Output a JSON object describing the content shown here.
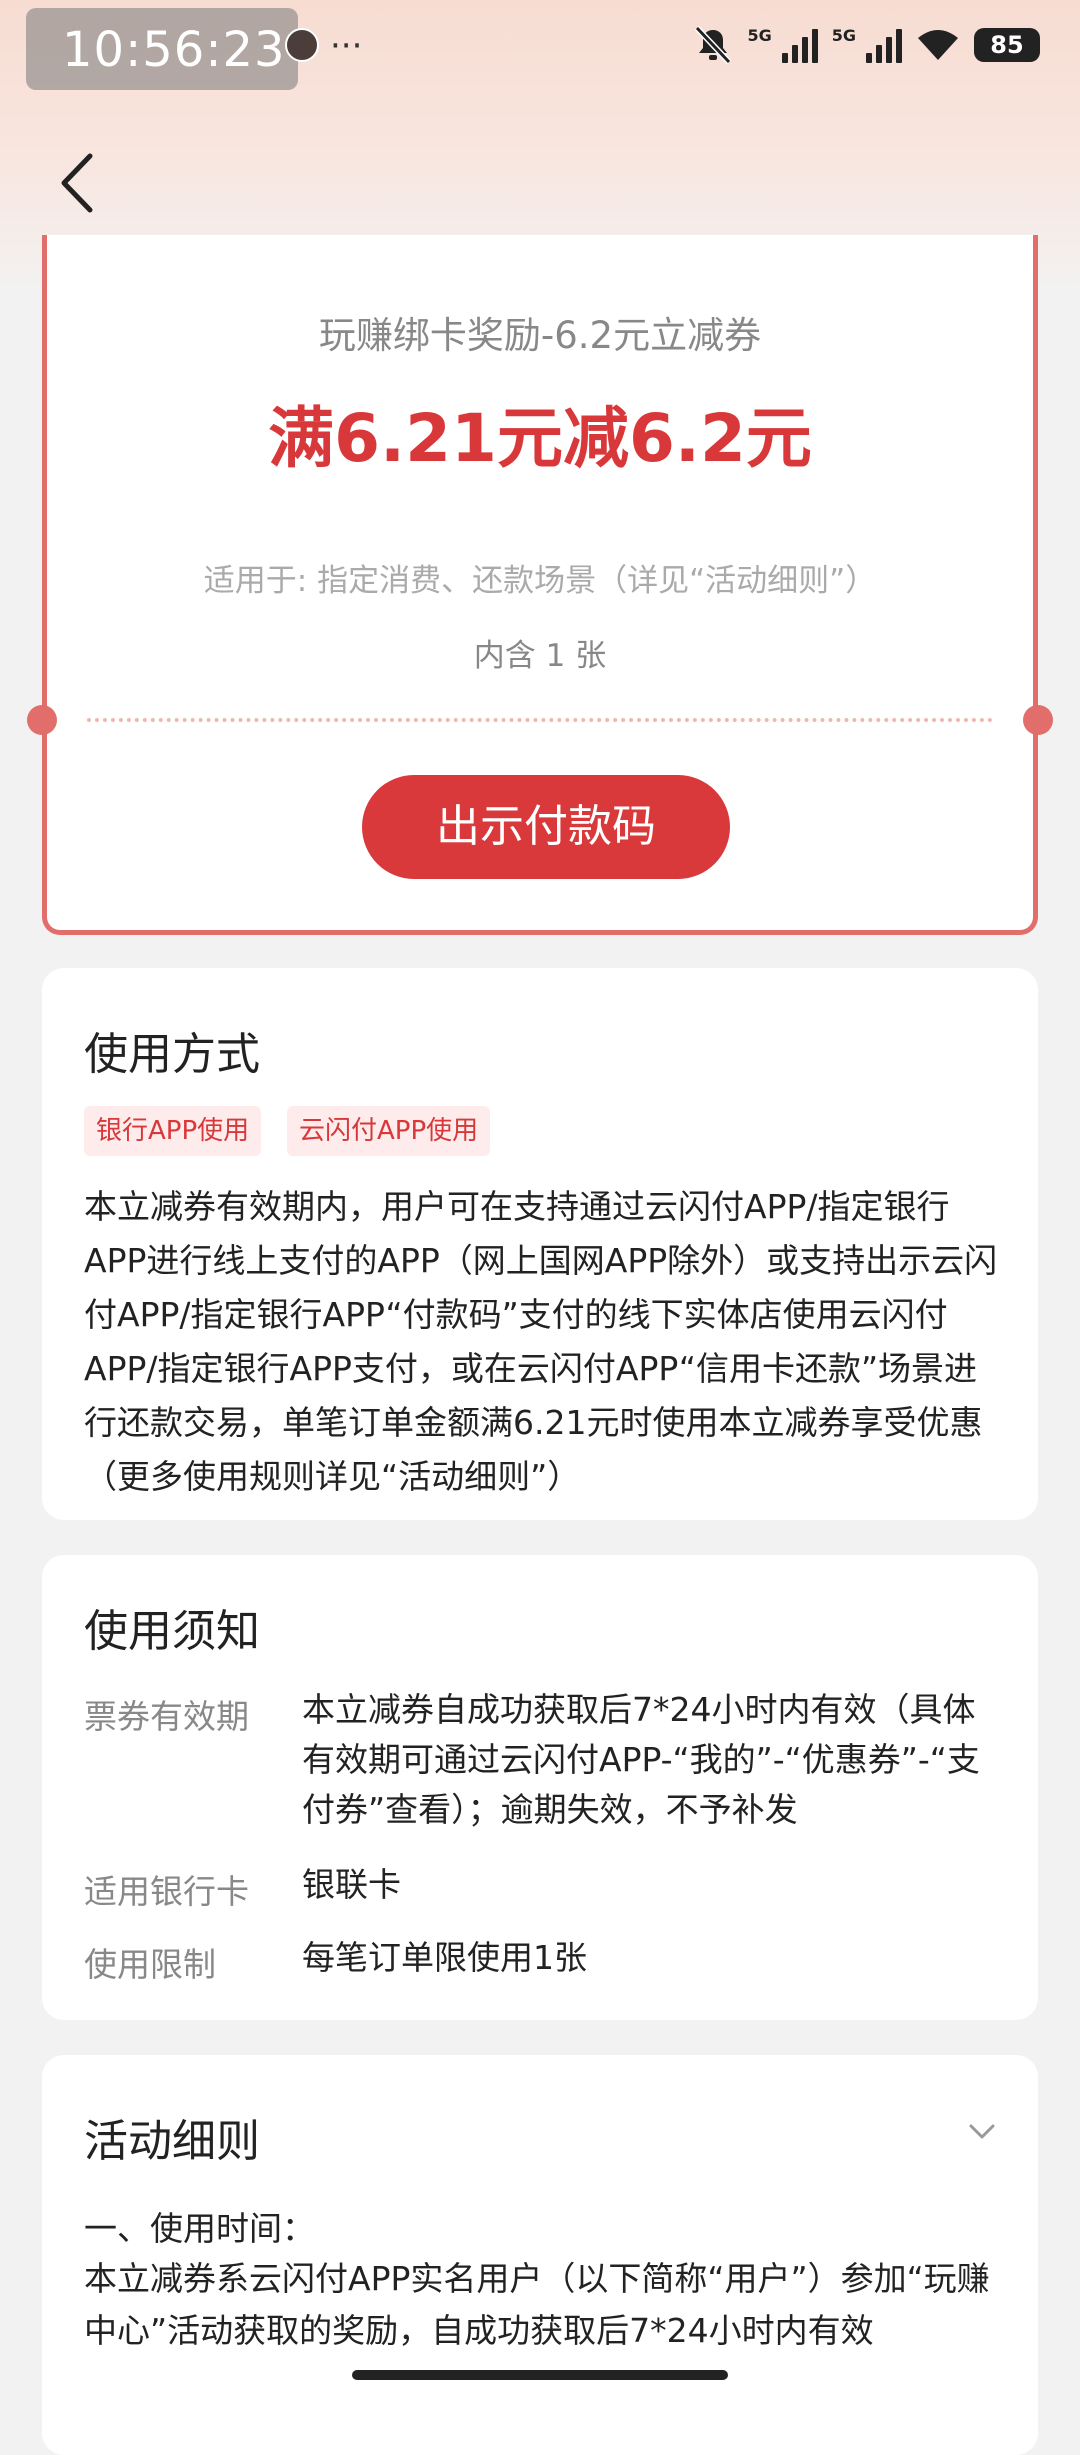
{
  "status_bar": {
    "time": "10:56:23",
    "more": "···",
    "net1": "5G",
    "net2": "5G",
    "battery": "85"
  },
  "coupon": {
    "title": "玩赚绑卡奖励-6.2元立减券",
    "amount": "满6.21元减6.2元",
    "scope": "适用于: 指定消费、还款场景（详见“活动细则”）",
    "count": "内含 1 张",
    "button": "出示付款码"
  },
  "usage": {
    "heading": "使用方式",
    "tags": [
      "银行APP使用",
      "云闪付APP使用"
    ],
    "body": "本立减券有效期内，用户可在支持通过云闪付APP/指定银行APP进行线上支付的APP（网上国网APP除外）或支持出示云闪付APP/指定银行APP“付款码”支付的线下实体店使用云闪付APP/指定银行APP支付，或在云闪付APP“信用卡还款”场景进行还款交易，单笔订单金额满6.21元时使用本立减券享受优惠（更多使用规则详见“活动细则”）"
  },
  "notice": {
    "heading": "使用须知",
    "rows": [
      {
        "key": "票券有效期",
        "value": "本立减券自成功获取后7*24小时内有效（具体有效期可通过云闪付APP-“我的”-“优惠券”-“支付券”查看）；逾期失效，不予补发"
      },
      {
        "key": "适用银行卡",
        "value": "银联卡"
      },
      {
        "key": "使用限制",
        "value": "每笔订单限使用1张"
      }
    ]
  },
  "rules": {
    "heading": "活动细则",
    "section1": "一、使用时间：",
    "text": "本立减券系云闪付APP实名用户（以下简称“用户”）参加“玩赚中心”活动获取的奖励，自成功获取后7*24小时内有效"
  }
}
